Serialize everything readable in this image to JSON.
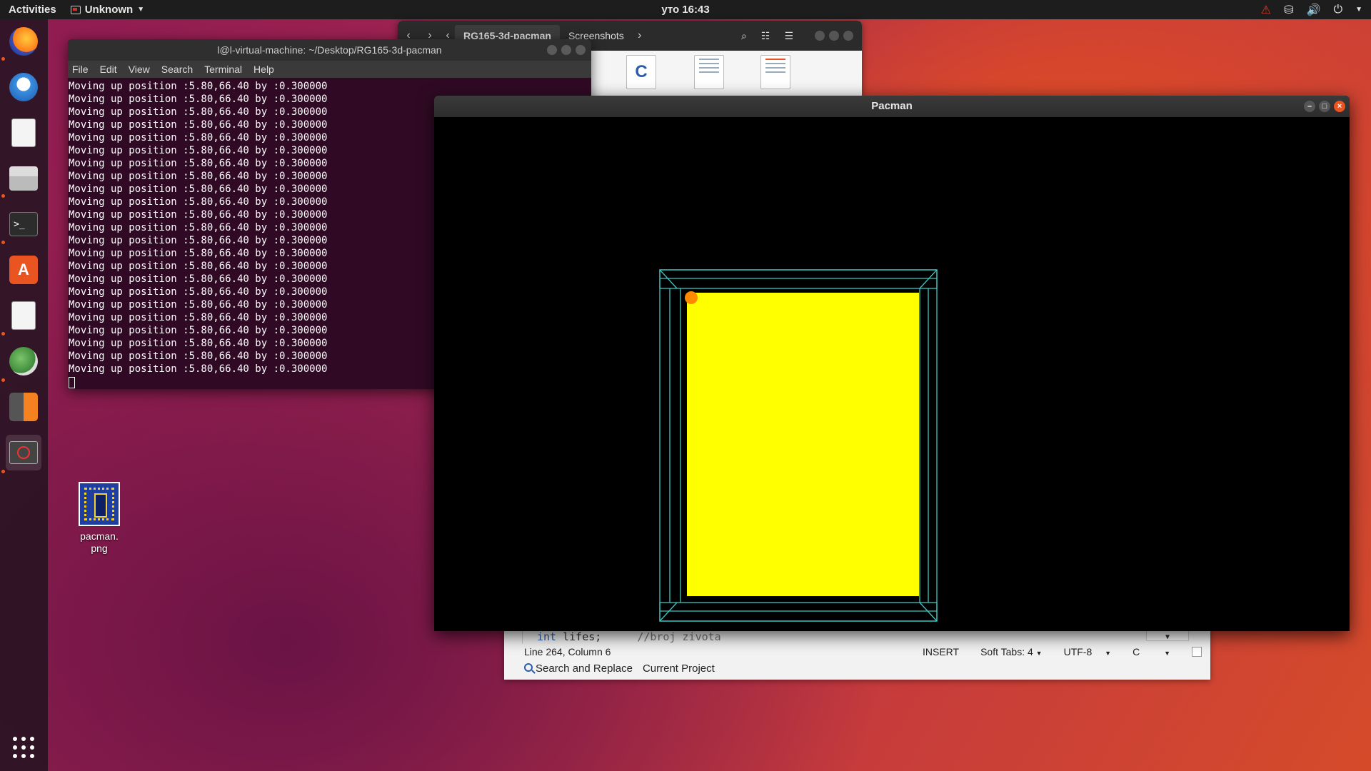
{
  "topbar": {
    "activities": "Activities",
    "app_menu": "Unknown",
    "clock": "уто 16:43",
    "tray_icons": [
      "warning-icon",
      "network-icon",
      "volume-icon",
      "power-icon"
    ]
  },
  "dock": {
    "items": [
      "firefox",
      "thunderbird",
      "text-editor",
      "files",
      "terminal",
      "software-center",
      "text-editor-2",
      "image-viewer",
      "calculator",
      "pacman-app"
    ]
  },
  "desktop": {
    "icon_label": "pacman.\npng"
  },
  "files_window": {
    "breadcrumb_current": "RG165-3d-pacman",
    "breadcrumb_next": "Screenshots"
  },
  "terminal": {
    "title": "l@l-virtual-machine: ~/Desktop/RG165-3d-pacman",
    "menu": [
      "File",
      "Edit",
      "View",
      "Search",
      "Terminal",
      "Help"
    ],
    "line": "Moving up position :5.80,66.40 by :0.300000",
    "line_count": 23
  },
  "editor": {
    "code_kw": "int",
    "code_text": " lifes;",
    "code_comment": "//broj zivota",
    "status": {
      "position": "Line 264, Column 6",
      "mode": "INSERT",
      "tabs": "Soft Tabs: 4",
      "encoding": "UTF-8",
      "language": "C"
    },
    "panel_search": "Search and Replace",
    "panel_project": "Current Project"
  },
  "pacman_window": {
    "title": "Pacman"
  },
  "colors": {
    "accent": "#e95420",
    "wireframe": "#3fc7c2",
    "board": "#ffff00",
    "pacman": "#ff8a00",
    "terminal_bg": "#300a24"
  }
}
